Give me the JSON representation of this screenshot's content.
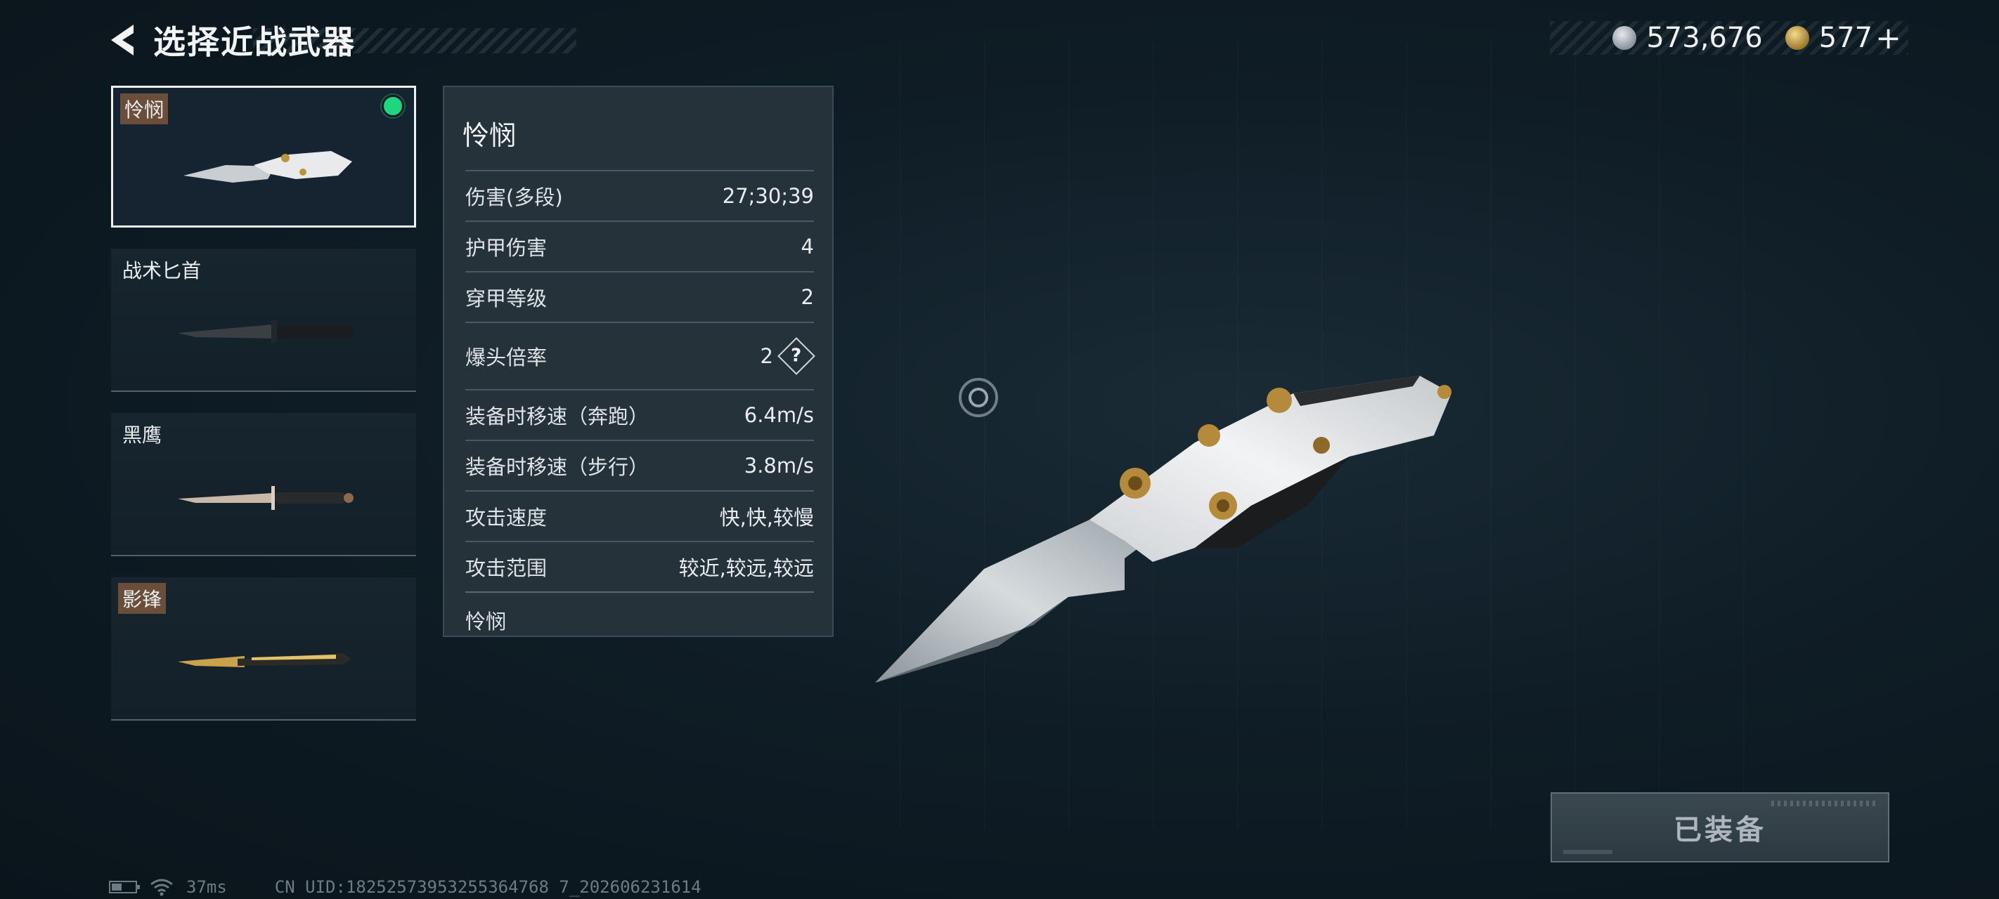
{
  "header": {
    "title": "选择近战武器"
  },
  "currency": [
    {
      "icon": "silver-coin-icon",
      "value": "573,676"
    },
    {
      "icon": "gold-coin-icon",
      "value": "577"
    }
  ],
  "currency_plus": "+",
  "weapons": [
    {
      "name": "怜悯",
      "selected": true,
      "equipped": true
    },
    {
      "name": "战术匕首",
      "selected": false,
      "equipped": false
    },
    {
      "name": "黑鹰",
      "selected": false,
      "equipped": false
    },
    {
      "name": "影锋",
      "selected": false,
      "equipped": false
    }
  ],
  "stats": {
    "title": "怜悯",
    "rows": [
      {
        "label": "伤害(多段)",
        "value": "27;30;39"
      },
      {
        "label": "护甲伤害",
        "value": "4"
      },
      {
        "label": "穿甲等级",
        "value": "2"
      },
      {
        "label": "爆头倍率",
        "value": "2",
        "help": "?"
      },
      {
        "label": "装备时移速（奔跑）",
        "value": "6.4m/s"
      },
      {
        "label": "装备时移速（步行）",
        "value": "3.8m/s"
      },
      {
        "label": "攻击速度",
        "value": "快,快,较慢"
      },
      {
        "label": "攻击范围",
        "value": "较近,较远,较远"
      }
    ],
    "footer": "怜悯"
  },
  "equip_button": {
    "label": "已装备"
  },
  "status": {
    "ping": "37ms",
    "uid": "CN UID:18252573953255364768 7_202606231614"
  },
  "colors": {
    "accent_green": "#1ed67f",
    "panel_bg": "#28343c"
  }
}
